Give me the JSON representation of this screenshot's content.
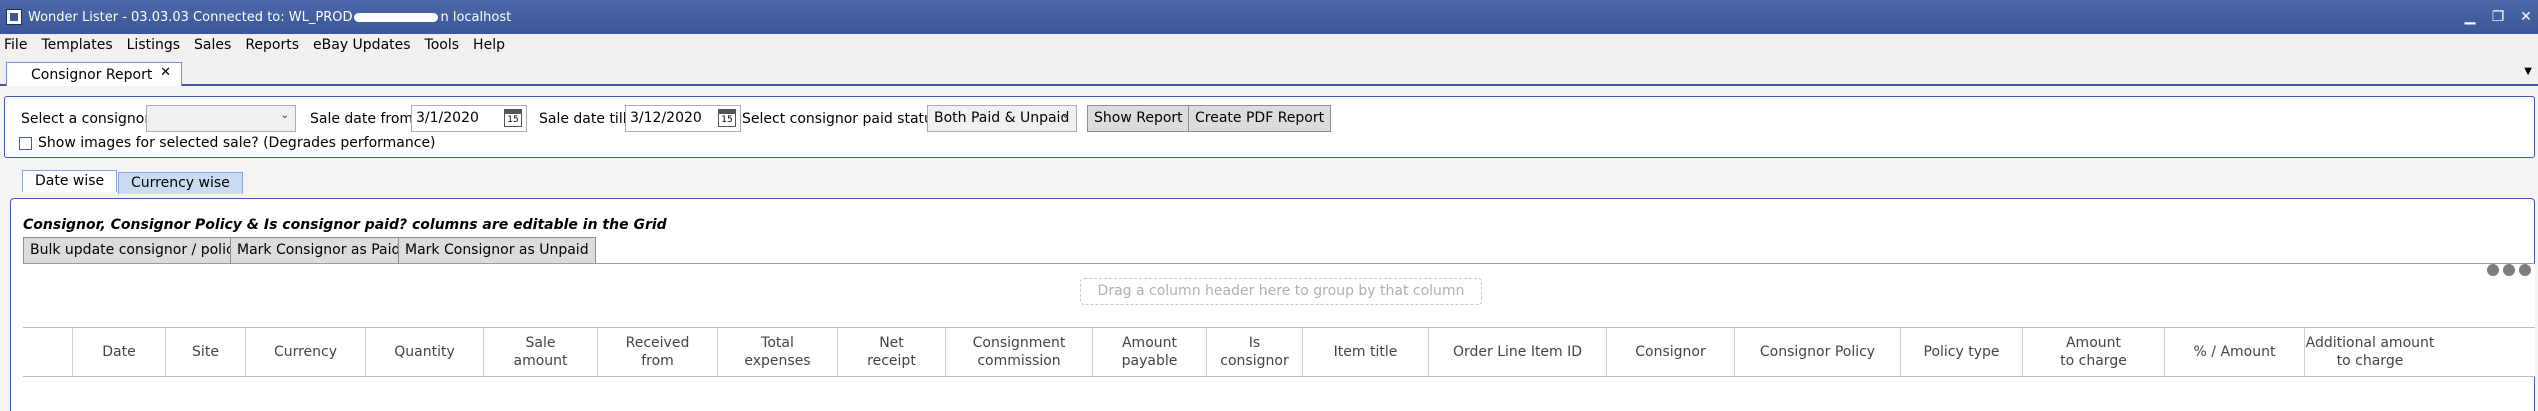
{
  "window": {
    "title_before": "Wonder Lister - 03.03.03 Connected to: WL_PROD",
    "title_after": "n localhost",
    "minimize": "▁",
    "restore": "❐",
    "close": "✕"
  },
  "menu": [
    "File",
    "Templates",
    "Listings",
    "Sales",
    "Reports",
    "eBay Updates",
    "Tools",
    "Help"
  ],
  "doc_tab": {
    "label": "Consignor Report",
    "close": "✕"
  },
  "filters": {
    "consignor_label": "Select a consignor:",
    "consignor_value": "",
    "from_label": "Sale date from:",
    "from_value": "3/1/2020",
    "till_label": "Sale date till:",
    "till_value": "3/12/2020",
    "calendar_day": "15",
    "status_label": "Select consignor paid status:",
    "status_value": "Both Paid & Unpaid",
    "show_report": "Show Report",
    "create_pdf": "Create PDF Report",
    "show_images_label": "Show images for selected sale? (Degrades performance)"
  },
  "inner_tabs": [
    "Date wise",
    "Currency wise"
  ],
  "grid": {
    "note": "Consignor, Consignor Policy & Is consignor paid? columns are editable in the Grid",
    "bulk_update": "Bulk update consignor / policy",
    "mark_paid": "Mark Consignor as Paid",
    "mark_unpaid": "Mark Consignor as Unpaid",
    "group_hint": "Drag a column header here to group by that column",
    "columns": [
      "",
      "Date",
      "Site",
      "Currency",
      "Quantity",
      "Sale\namount",
      "Received\nfrom",
      "Total\nexpenses",
      "Net\nreceipt",
      "Consignment\ncommission",
      "Amount\npayable",
      "Is\nconsignor",
      "Item title",
      "Order Line Item ID",
      "Consignor",
      "Consignor Policy",
      "Policy type",
      "Amount\nto charge",
      "% / Amount",
      "Additional amount\nto charge"
    ]
  },
  "colors": {
    "accent": "#3d58a8",
    "titlebar": "#3f5c9c",
    "inactive_tab": "#c9dcf2"
  }
}
